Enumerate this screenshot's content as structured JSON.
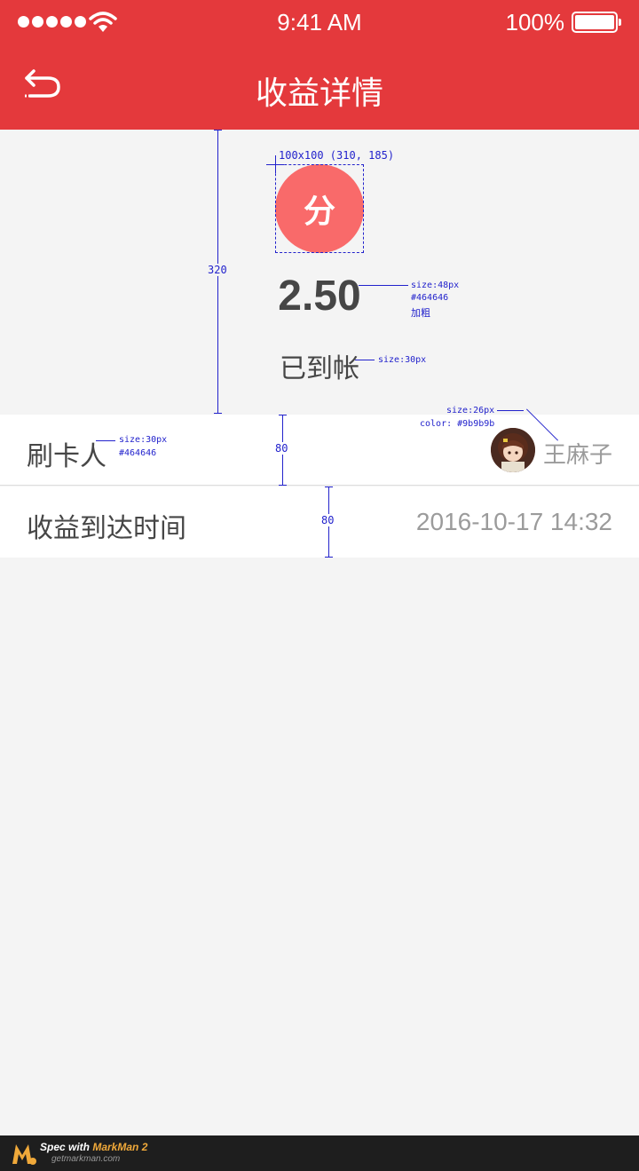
{
  "status_bar": {
    "time": "9:41 AM",
    "battery": "100%"
  },
  "nav": {
    "title": "收益详情",
    "back_icon": "back-arrow-icon"
  },
  "hero": {
    "coin_label": "分",
    "amount": "2.50",
    "status": "已到帐"
  },
  "rows": {
    "payer": {
      "label": "刷卡人",
      "name": "王麻子"
    },
    "arrival": {
      "label": "收益到达时间",
      "time": "2016-10-17  14:32"
    }
  },
  "colors": {
    "primary": "#e4393c",
    "coin": "#f96a6a",
    "text": "#464646",
    "muted": "#9b9b9b",
    "background": "#f4f4f4"
  },
  "annotations": {
    "coin_box": "100x100 (310, 185)",
    "amount_size": "size:48px",
    "amount_color": "#464646",
    "amount_weight": "加粗",
    "status_size": "size:30px",
    "hero_height": "320",
    "label_size": "size:30px",
    "label_color": "#464646",
    "name_size": "size:26px",
    "name_color": "color: #9b9b9b",
    "row1_height": "80",
    "row2_height": "80"
  },
  "footer": {
    "prefix": "Spec with ",
    "brand": "MarkMan 2",
    "url": "getmarkman.com"
  }
}
